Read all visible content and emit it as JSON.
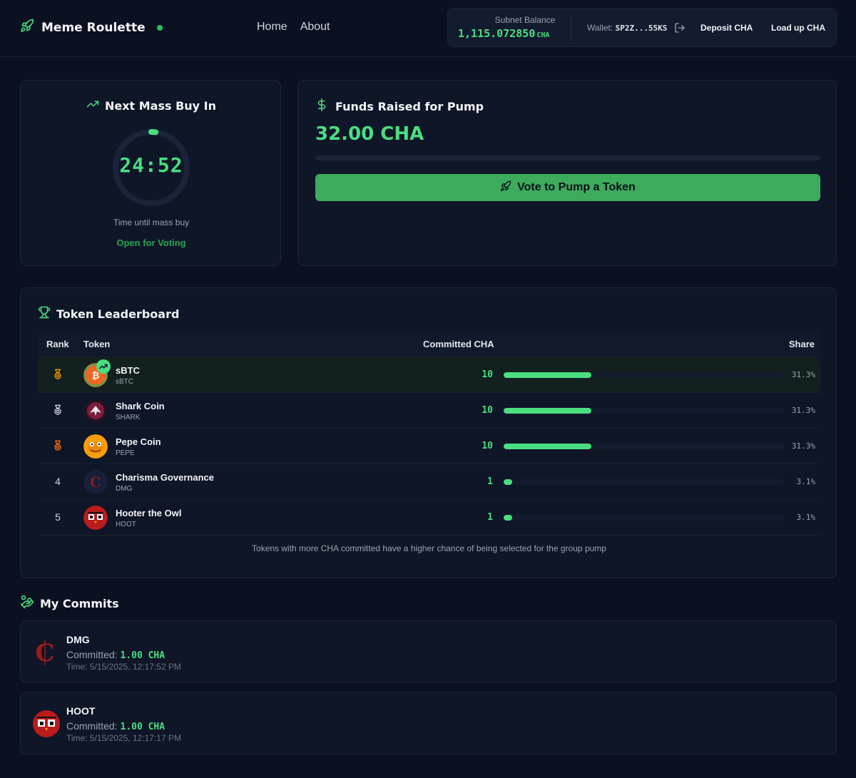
{
  "header": {
    "brand": "Meme Roulette",
    "nav": [
      "Home",
      "About"
    ],
    "balance_label": "Subnet Balance",
    "balance_value": "1,115.072850",
    "balance_unit": "CHA",
    "wallet_label": "Wallet:",
    "wallet_address": "SP2Z...55KS",
    "deposit_label": "Deposit CHA",
    "loadup_label": "Load up CHA"
  },
  "timer": {
    "title": "Next Mass Buy In",
    "value": "24:52",
    "caption": "Time until mass buy",
    "status": "Open for Voting",
    "progress": 0.02
  },
  "funds": {
    "title": "Funds Raised for Pump",
    "amount": "32.00 CHA",
    "progress": 0,
    "vote_label": "Vote to Pump a Token"
  },
  "leaderboard": {
    "title": "Token Leaderboard",
    "columns": {
      "rank": "Rank",
      "token": "Token",
      "committed": "Committed CHA",
      "share": "Share"
    },
    "rows": [
      {
        "rank": "1",
        "rank_icon": "medal-gold-icon",
        "name": "sBTC",
        "symbol": "sBTC",
        "amount": "10",
        "share": "31.3%",
        "share_value": 0.313,
        "trending": true
      },
      {
        "rank": "2",
        "rank_icon": "medal-silver-icon",
        "name": "Shark Coin",
        "symbol": "SHARK",
        "amount": "10",
        "share": "31.3%",
        "share_value": 0.313
      },
      {
        "rank": "3",
        "rank_icon": "medal-bronze-icon",
        "name": "Pepe Coin",
        "symbol": "PEPE",
        "amount": "10",
        "share": "31.3%",
        "share_value": 0.313
      },
      {
        "rank": "4",
        "name": "Charisma Governance",
        "symbol": "DMG",
        "amount": "1",
        "share": "3.1%",
        "share_value": 0.031
      },
      {
        "rank": "5",
        "name": "Hooter the Owl",
        "symbol": "HOOT",
        "amount": "1",
        "share": "3.1%",
        "share_value": 0.031
      }
    ],
    "footnote": "Tokens with more CHA committed have a higher chance of being selected for the group pump"
  },
  "commits": {
    "title": "My Commits",
    "committed_label": "Committed:",
    "items": [
      {
        "symbol": "DMG",
        "amount": "1.00 CHA",
        "time": "Time: 5/15/2025, 12:17:52 PM"
      },
      {
        "symbol": "HOOT",
        "amount": "1.00 CHA",
        "time": "Time: 5/15/2025, 12:17:17 PM"
      }
    ]
  },
  "colors": {
    "accent": "#4ade80",
    "background": "#0b1120",
    "card": "#0f1628",
    "button": "#3dab5b",
    "gold": "#f59e0b",
    "silver": "#d1d5db",
    "bronze": "#f97316"
  }
}
